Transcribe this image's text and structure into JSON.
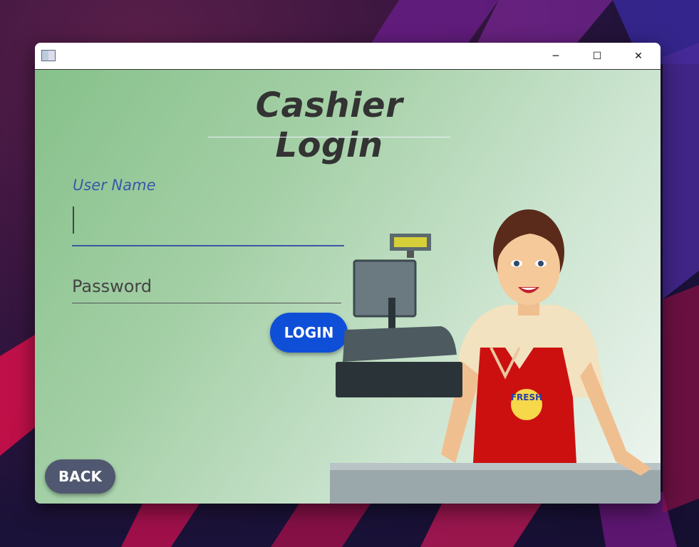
{
  "window": {
    "title": "",
    "controls": {
      "minimize": "─",
      "maximize": "☐",
      "close": "✕"
    }
  },
  "page": {
    "heading": "Cashier Login"
  },
  "form": {
    "username_label": "User Name",
    "username_value": "",
    "password_placeholder": "Password",
    "password_value": "",
    "login_label": "LOGIN"
  },
  "footer": {
    "back_label": "BACK"
  },
  "illustration": {
    "subject": "cashier-with-register",
    "apron_logo_text": "FRESH"
  },
  "colors": {
    "login_button": "#0f4fd8",
    "back_button": "#4f5870",
    "heading": "#333333",
    "username_label": "#3a58a8",
    "apron": "#cc1010"
  }
}
